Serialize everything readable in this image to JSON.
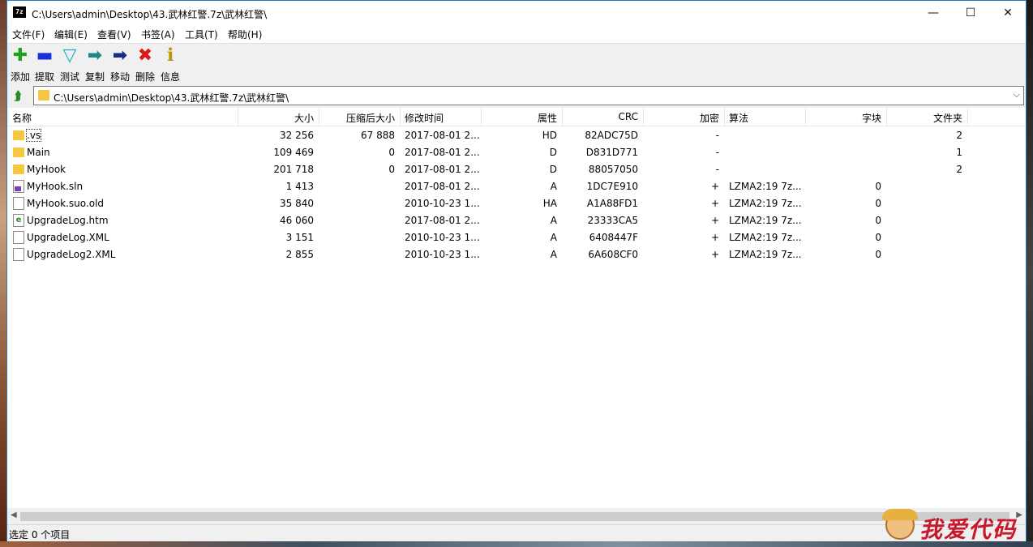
{
  "window": {
    "title": "C:\\Users\\admin\\Desktop\\43.武林红警.7z\\武林红警\\",
    "app_icon_text": "7z",
    "controls": {
      "minimize": "—",
      "maximize": "☐",
      "close": "✕"
    }
  },
  "menu": [
    "文件(F)",
    "编辑(E)",
    "查看(V)",
    "书签(A)",
    "工具(T)",
    "帮助(H)"
  ],
  "toolbar": [
    {
      "label": "添加",
      "icon": "add-icon",
      "glyph": "✚",
      "color": "#1aa31a"
    },
    {
      "label": "提取",
      "icon": "extract-icon",
      "glyph": "▬",
      "color": "#1a2fd6"
    },
    {
      "label": "测试",
      "icon": "test-icon",
      "glyph": "▽",
      "color": "#1ab0c8"
    },
    {
      "label": "复制",
      "icon": "copy-icon",
      "glyph": "➡",
      "color": "#1a8a8a"
    },
    {
      "label": "移动",
      "icon": "move-icon",
      "glyph": "➡",
      "color": "#1a2a8a"
    },
    {
      "label": "删除",
      "icon": "delete-icon",
      "glyph": "✖",
      "color": "#d81a1a"
    },
    {
      "label": "信息",
      "icon": "info-icon",
      "glyph": "ℹ",
      "color": "#b89a00"
    }
  ],
  "address": {
    "path": "C:\\Users\\admin\\Desktop\\43.武林红警.7z\\武林红警\\"
  },
  "columns": [
    "名称",
    "大小",
    "压缩后大小",
    "修改时间",
    "属性",
    "CRC",
    "加密",
    "算法",
    "字块",
    "文件夹"
  ],
  "files": [
    {
      "name": ".vs",
      "type": "folder",
      "size": "32 256",
      "packed": "67 888",
      "modified": "2017-08-01 2...",
      "attr": "HD",
      "crc": "82ADC75D",
      "enc": "-",
      "method": "",
      "block": "",
      "folders": "2"
    },
    {
      "name": "Main",
      "type": "folder",
      "size": "109 469",
      "packed": "0",
      "modified": "2017-08-01 2...",
      "attr": "D",
      "crc": "D831D771",
      "enc": "-",
      "method": "",
      "block": "",
      "folders": "1"
    },
    {
      "name": "MyHook",
      "type": "folder",
      "size": "201 718",
      "packed": "0",
      "modified": "2017-08-01 2...",
      "attr": "D",
      "crc": "88057050",
      "enc": "-",
      "method": "",
      "block": "",
      "folders": "2"
    },
    {
      "name": "MyHook.sln",
      "type": "sln",
      "size": "1 413",
      "packed": "",
      "modified": "2017-08-01 2...",
      "attr": "A",
      "crc": "1DC7E910",
      "enc": "+",
      "method": "LZMA2:19 7z...",
      "block": "0",
      "folders": ""
    },
    {
      "name": "MyHook.suo.old",
      "type": "file",
      "size": "35 840",
      "packed": "",
      "modified": "2010-10-23 1...",
      "attr": "HA",
      "crc": "A1A88FD1",
      "enc": "+",
      "method": "LZMA2:19 7z...",
      "block": "0",
      "folders": ""
    },
    {
      "name": "UpgradeLog.htm",
      "type": "htm",
      "size": "46 060",
      "packed": "",
      "modified": "2017-08-01 2...",
      "attr": "A",
      "crc": "23333CA5",
      "enc": "+",
      "method": "LZMA2:19 7z...",
      "block": "0",
      "folders": ""
    },
    {
      "name": "UpgradeLog.XML",
      "type": "file",
      "size": "3 151",
      "packed": "",
      "modified": "2010-10-23 1...",
      "attr": "A",
      "crc": "6408447F",
      "enc": "+",
      "method": "LZMA2:19 7z...",
      "block": "0",
      "folders": ""
    },
    {
      "name": "UpgradeLog2.XML",
      "type": "file",
      "size": "2 855",
      "packed": "",
      "modified": "2010-10-23 1...",
      "attr": "A",
      "crc": "6A608CF0",
      "enc": "+",
      "method": "LZMA2:19 7z...",
      "block": "0",
      "folders": ""
    }
  ],
  "status": {
    "text": "选定 0 个项目"
  },
  "watermark": {
    "text": "我爱代码"
  }
}
